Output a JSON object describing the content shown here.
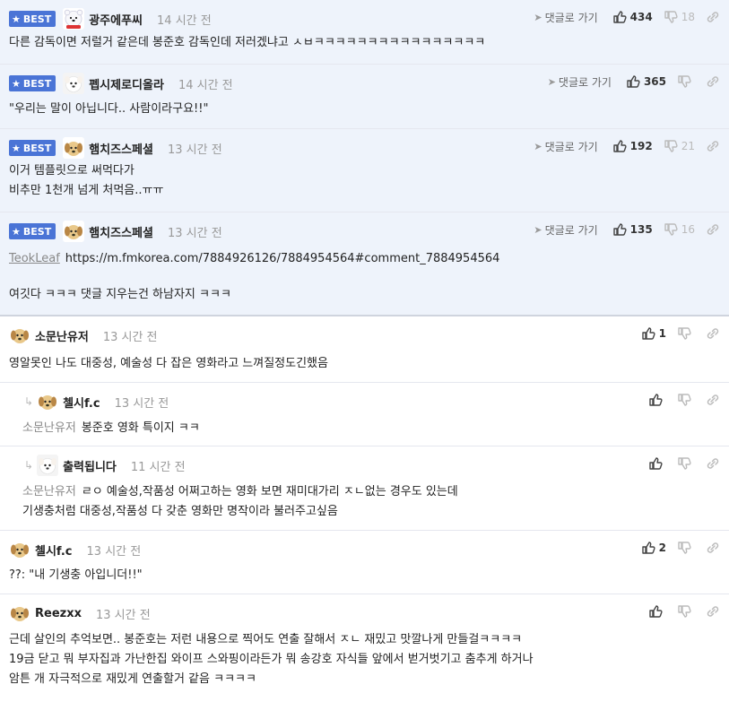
{
  "badge_label": "BEST",
  "goto_label": "댓글로 가기",
  "colors": {
    "badge": "#4a74d6",
    "best_bg": "#eef3fb",
    "accent": "#4a74d6"
  },
  "best_comments": [
    {
      "nick": "광주에푸씨",
      "time": "14 시간 전",
      "up": "434",
      "down": "18",
      "avatar": "polar-bear-avatar",
      "lines": [
        "다른 감독이면 저럴거 같은데 봉준호 감독인데 저러겠냐고 ㅅㅂㅋㅋㅋㅋㅋㅋㅋㅋㅋㅋㅋㅋㅋㅋㅋㅋ"
      ]
    },
    {
      "nick": "펩시제로디올라",
      "time": "14 시간 전",
      "up": "365",
      "down": "",
      "avatar": "white-dog-avatar",
      "lines": [
        "\"우리는 말이 아닙니다.. 사람이라구요!!\""
      ]
    },
    {
      "nick": "햄치즈스페셜",
      "time": "13 시간 전",
      "up": "192",
      "down": "21",
      "avatar": "puppy-avatar",
      "lines": [
        "이거 템플릿으로 써먹다가",
        "비추만 1천개 넘게 처먹음..ㅠㅠ"
      ]
    },
    {
      "nick": "햄치즈스페셜",
      "time": "13 시간 전",
      "up": "135",
      "down": "16",
      "avatar": "puppy-avatar",
      "teok": "TeokLeaf",
      "url": "https://m.fmkorea.com/7884926126/7884954564#comment_7884954564",
      "lines": [
        "여깃다 ㅋㅋㅋ 댓글 지우는건 하남자지 ㅋㅋㅋ"
      ]
    }
  ],
  "comments": [
    {
      "nick": "소문난유저",
      "time": "13 시간 전",
      "up": "1",
      "avatar": "puppy-avatar",
      "lines": [
        "영알못인 나도 대중성, 예술성 다 잡은 영화라고 느껴질정도긴했음"
      ]
    },
    {
      "nick": "첼시f.c",
      "time": "13 시간 전",
      "up": "",
      "avatar": "puppy-avatar",
      "parent": "소문난유저",
      "lines": [
        "봉준호 영화 특이지 ㅋㅋ"
      ]
    },
    {
      "nick": "출력됩니다",
      "time": "11 시간 전",
      "up": "",
      "avatar": "white-dog-avatar",
      "parent": "소문난유저",
      "lines": [
        "ㄹㅇ 예술성,작품성 어쩌고하는 영화 보면 재미대가리 ㅈㄴ없는 경우도 있는데",
        "기생충처럼 대중성,작품성 다 갖춘 영화만 명작이라 불러주고싶음"
      ]
    },
    {
      "nick": "첼시f.c",
      "time": "13 시간 전",
      "up": "2",
      "avatar": "puppy-avatar",
      "lines": [
        "??: \"내 기생충 아입니더!!\""
      ]
    },
    {
      "nick": "Reezxx",
      "time": "13 시간 전",
      "up": "",
      "avatar": "puppy-avatar",
      "lines": [
        "근데 살인의 추억보면.. 봉준호는 저런 내용으로 찍어도 연출 잘해서 ㅈㄴ 재밌고 맛깔나게 만들걸ㅋㅋㅋㅋ",
        "19금 닫고 뭐 부자집과 가난한집 와이프 스와핑이라든가 뭐 송강호 자식들 앞에서 벋거벗기고 춤추게 하거나",
        "암튼 개 자극적으로 재밌게 연출할거 같음 ㅋㅋㅋㅋ"
      ]
    }
  ]
}
